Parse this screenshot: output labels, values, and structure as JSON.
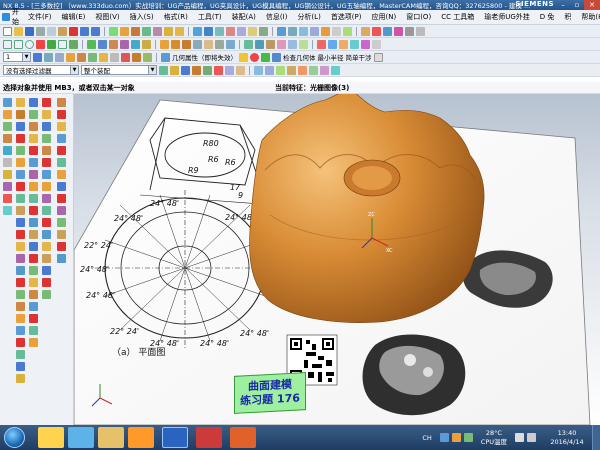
{
  "titlebar": {
    "title": "NX 8.5 - [三多数控] （www.333duo.com）实战培训：UG产品编程，UG夹具设计，UG模具编程，UG钢公设计，UG五轴编程，MasterCAM编程，咨询QQ：327625800 - 建模 ...",
    "brand": "SIEMENS"
  },
  "menubar": {
    "start": "开始",
    "items": [
      "文件(F)",
      "编辑(E)",
      "视图(V)",
      "插入(S)",
      "格式(R)",
      "工具(T)",
      "装配(A)",
      "信息(I)",
      "分析(L)",
      "首选项(P)",
      "应用(N)",
      "窗口(O)",
      "CC 工具箱",
      "瑜老师UG外挂",
      "D 免",
      "积",
      "帮助(H)"
    ]
  },
  "toolbar": {
    "feature_label": "几何属性（即将失效）",
    "check_label": "检查几何体",
    "min_radius_label": "最小半径",
    "simple_interference": "简单干涉",
    "selection_filter": "没有选择过滤器",
    "assembly_scope": "整个装配",
    "count_value": "1"
  },
  "statusline": {
    "prompt": "选择对象并使用 MB3，或者双击某一对象",
    "current_feature": "当前特征：光栅图像(3)"
  },
  "drawing": {
    "dims": {
      "r80": "R80",
      "r6a": "R6",
      "r6b": "R6",
      "r9": "R9",
      "n17": "17",
      "n9": "9"
    },
    "angle_label": "24° 48'",
    "angle_label_alt": "22° 24'",
    "caption": "（a） 平面图"
  },
  "banner": {
    "line1": "曲面建模",
    "line2": "练习题 176"
  },
  "taskbar": {
    "temp": "28°C",
    "temp_label": "CPU温度",
    "time": "13:40",
    "date": "2016/4/14",
    "lang": "CH"
  },
  "colors": {
    "accent": "#c77d2e",
    "titlebar": "#23548c",
    "banner_bg": "#9ef0a0",
    "banner_text": "#1a2aa6"
  }
}
